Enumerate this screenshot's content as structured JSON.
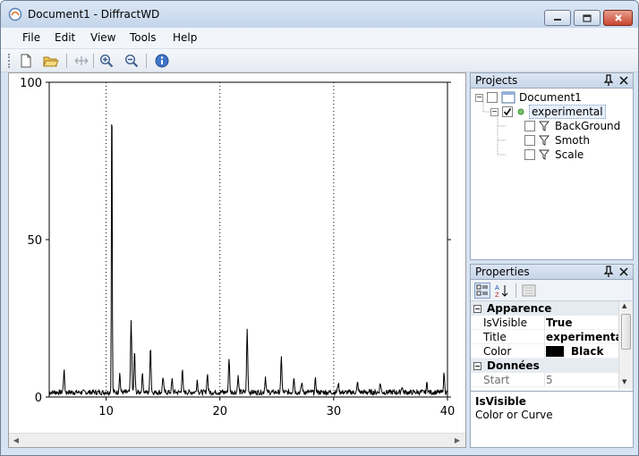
{
  "window": {
    "title": "Document1 - DiffractWD",
    "controls": [
      "minimize-icon",
      "maximize-icon",
      "close-icon"
    ]
  },
  "menu": {
    "file": "File",
    "edit": "Edit",
    "view": "View",
    "tools": "Tools",
    "help": "Help"
  },
  "toolbar": {
    "buttons": [
      "new-document-icon",
      "open-folder-icon",
      "fit-width-icon",
      "zoom-in-icon",
      "zoom-out-icon",
      "info-icon"
    ]
  },
  "projects": {
    "title": "Projects",
    "tree": [
      {
        "label": "Document1",
        "checked": false,
        "level": 0
      },
      {
        "label": "experimental",
        "checked": true,
        "level": 1
      },
      {
        "label": "BackGround",
        "checked": false,
        "level": 2
      },
      {
        "label": "Smoth",
        "checked": false,
        "level": 2
      },
      {
        "label": "Scale",
        "checked": false,
        "level": 2
      }
    ]
  },
  "properties": {
    "title": "Properties",
    "categories": [
      {
        "name": "Apparence",
        "rows": [
          {
            "name": "IsVisible",
            "value": "True"
          },
          {
            "name": "Title",
            "value": "experimental"
          },
          {
            "name": "Color",
            "value": "Black",
            "swatch": "#000000"
          }
        ]
      },
      {
        "name": "Données",
        "rows": [
          {
            "name": "Start",
            "value": "5"
          }
        ]
      }
    ],
    "description": {
      "title": "IsVisible",
      "text": "Color or Curve"
    }
  },
  "colors": {
    "accent": "#c7d6ea",
    "curve": "#000000"
  },
  "chart_data": {
    "type": "line",
    "xlim": [
      5,
      40
    ],
    "ylim": [
      0,
      100
    ],
    "xticks": [
      10,
      20,
      30,
      40
    ],
    "yticks": [
      0,
      50,
      100
    ],
    "vertical_guides": [
      10,
      20,
      30
    ],
    "baseline": 1.5,
    "peaks": [
      {
        "x": 6.3,
        "y": 7
      },
      {
        "x": 10.5,
        "y": 100
      },
      {
        "x": 11.2,
        "y": 6
      },
      {
        "x": 12.2,
        "y": 23
      },
      {
        "x": 12.5,
        "y": 13
      },
      {
        "x": 13.2,
        "y": 6
      },
      {
        "x": 13.9,
        "y": 15
      },
      {
        "x": 15.0,
        "y": 5
      },
      {
        "x": 15.8,
        "y": 4
      },
      {
        "x": 16.7,
        "y": 7
      },
      {
        "x": 18.0,
        "y": 4
      },
      {
        "x": 18.9,
        "y": 6
      },
      {
        "x": 20.8,
        "y": 11
      },
      {
        "x": 21.6,
        "y": 5
      },
      {
        "x": 22.4,
        "y": 20
      },
      {
        "x": 24.0,
        "y": 5
      },
      {
        "x": 25.4,
        "y": 11
      },
      {
        "x": 26.5,
        "y": 5
      },
      {
        "x": 27.2,
        "y": 3
      },
      {
        "x": 28.4,
        "y": 4
      },
      {
        "x": 30.4,
        "y": 3
      },
      {
        "x": 32.1,
        "y": 3
      },
      {
        "x": 34.1,
        "y": 3
      },
      {
        "x": 36.0,
        "y": 2
      },
      {
        "x": 38.2,
        "y": 3
      },
      {
        "x": 39.7,
        "y": 6
      }
    ]
  }
}
